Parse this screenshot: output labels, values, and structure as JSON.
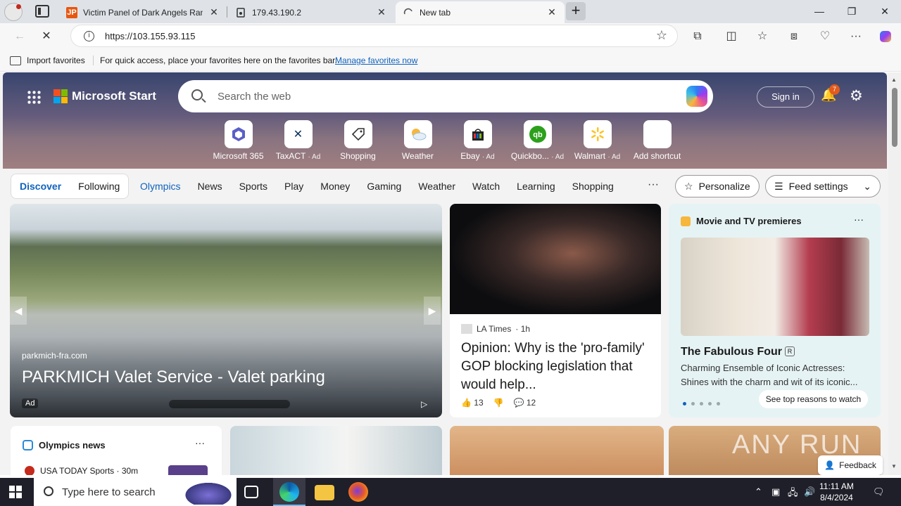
{
  "browser": {
    "tabs": [
      {
        "favicon": "JP",
        "title": "Victim Panel of Dark Angels Ran:",
        "close": "✕"
      },
      {
        "favicon": "lock-doc-icon",
        "title": "179.43.190.2",
        "close": "✕"
      },
      {
        "favicon": "loading-icon",
        "title": "New tab",
        "close": "✕",
        "active": true
      }
    ],
    "new_tab": "+",
    "window_controls": {
      "minimize": "—",
      "restore": "❐",
      "close": "✕"
    },
    "address": {
      "url": "https://103.155.93.115"
    },
    "favorites_bar": {
      "import_label": "Import favorites",
      "message": "For quick access, place your favorites here on the favorites bar.",
      "manage_link": "Manage favorites now"
    }
  },
  "msstart": {
    "brand": "Microsoft Start",
    "search_placeholder": "Search the web",
    "sign_in": "Sign in",
    "notification_count": "7",
    "shortcuts": [
      {
        "label": "Microsoft 365",
        "ad": "",
        "icon": "microsoft365-icon",
        "color": "#5b5fc7"
      },
      {
        "label": "TaxACT",
        "ad": "· Ad",
        "icon": "taxact-icon",
        "color": "#0b2f5b"
      },
      {
        "label": "Shopping",
        "ad": "",
        "icon": "tag-icon",
        "color": "#333333"
      },
      {
        "label": "Weather",
        "ad": "",
        "icon": "weather-icon",
        "color": "#f6b73c"
      },
      {
        "label": "Ebay",
        "ad": "· Ad",
        "icon": "ebay-icon",
        "color": "#e53238"
      },
      {
        "label": "Quickbo...",
        "ad": "· Ad",
        "icon": "quickbooks-icon",
        "color": "#2ca01c"
      },
      {
        "label": "Walmart",
        "ad": "· Ad",
        "icon": "walmart-icon",
        "color": "#0071dc"
      },
      {
        "label": "Add shortcut",
        "ad": "",
        "icon": "plus-icon",
        "color": "#333333"
      }
    ],
    "feed_toggle": {
      "discover": "Discover",
      "following": "Following"
    },
    "nav": [
      "Olympics",
      "News",
      "Sports",
      "Play",
      "Money",
      "Gaming",
      "Weather",
      "Watch",
      "Learning",
      "Shopping"
    ],
    "nav_more": "···",
    "personalize": "Personalize",
    "feed_settings": "Feed settings",
    "carousel": {
      "source": "parkmich-fra.com",
      "headline": "PARKMICH Valet Service - Valet parking",
      "ad_badge": "Ad"
    },
    "news": {
      "publisher": "LA Times",
      "age": "· 1h",
      "headline": "Opinion: Why is the 'pro-family' GOP blocking legislation that would help...",
      "likes": "13",
      "comments": "12"
    },
    "movies": {
      "header": "Movie and TV premieres",
      "title": "The Fabulous Four",
      "rating": "R",
      "description": "Charming Ensemble of Iconic Actresses: Shines with the charm and wit of its iconic...",
      "button": "See top reasons to watch"
    },
    "olympics_news": {
      "header": "Olympics news",
      "row_source": "USA TODAY Sports · 30m"
    },
    "watermark": "ANY RUN",
    "feedback": "Feedback"
  },
  "taskbar": {
    "search_placeholder": "Type here to search",
    "time": "11:11 AM",
    "date": "8/4/2024"
  }
}
